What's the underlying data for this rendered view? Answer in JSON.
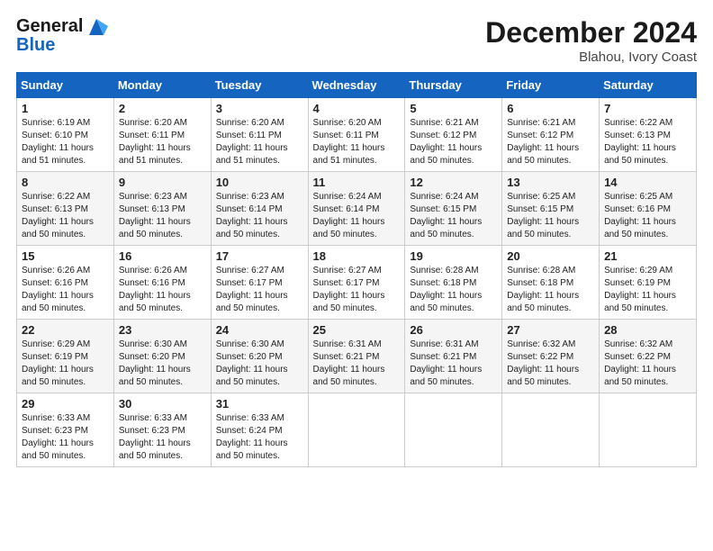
{
  "logo": {
    "line1": "General",
    "line2": "Blue"
  },
  "title": "December 2024",
  "location": "Blahou, Ivory Coast",
  "days_of_week": [
    "Sunday",
    "Monday",
    "Tuesday",
    "Wednesday",
    "Thursday",
    "Friday",
    "Saturday"
  ],
  "weeks": [
    [
      {
        "day": "1",
        "info": "Sunrise: 6:19 AM\nSunset: 6:10 PM\nDaylight: 11 hours\nand 51 minutes."
      },
      {
        "day": "2",
        "info": "Sunrise: 6:20 AM\nSunset: 6:11 PM\nDaylight: 11 hours\nand 51 minutes."
      },
      {
        "day": "3",
        "info": "Sunrise: 6:20 AM\nSunset: 6:11 PM\nDaylight: 11 hours\nand 51 minutes."
      },
      {
        "day": "4",
        "info": "Sunrise: 6:20 AM\nSunset: 6:11 PM\nDaylight: 11 hours\nand 51 minutes."
      },
      {
        "day": "5",
        "info": "Sunrise: 6:21 AM\nSunset: 6:12 PM\nDaylight: 11 hours\nand 50 minutes."
      },
      {
        "day": "6",
        "info": "Sunrise: 6:21 AM\nSunset: 6:12 PM\nDaylight: 11 hours\nand 50 minutes."
      },
      {
        "day": "7",
        "info": "Sunrise: 6:22 AM\nSunset: 6:13 PM\nDaylight: 11 hours\nand 50 minutes."
      }
    ],
    [
      {
        "day": "8",
        "info": "Sunrise: 6:22 AM\nSunset: 6:13 PM\nDaylight: 11 hours\nand 50 minutes."
      },
      {
        "day": "9",
        "info": "Sunrise: 6:23 AM\nSunset: 6:13 PM\nDaylight: 11 hours\nand 50 minutes."
      },
      {
        "day": "10",
        "info": "Sunrise: 6:23 AM\nSunset: 6:14 PM\nDaylight: 11 hours\nand 50 minutes."
      },
      {
        "day": "11",
        "info": "Sunrise: 6:24 AM\nSunset: 6:14 PM\nDaylight: 11 hours\nand 50 minutes."
      },
      {
        "day": "12",
        "info": "Sunrise: 6:24 AM\nSunset: 6:15 PM\nDaylight: 11 hours\nand 50 minutes."
      },
      {
        "day": "13",
        "info": "Sunrise: 6:25 AM\nSunset: 6:15 PM\nDaylight: 11 hours\nand 50 minutes."
      },
      {
        "day": "14",
        "info": "Sunrise: 6:25 AM\nSunset: 6:16 PM\nDaylight: 11 hours\nand 50 minutes."
      }
    ],
    [
      {
        "day": "15",
        "info": "Sunrise: 6:26 AM\nSunset: 6:16 PM\nDaylight: 11 hours\nand 50 minutes."
      },
      {
        "day": "16",
        "info": "Sunrise: 6:26 AM\nSunset: 6:16 PM\nDaylight: 11 hours\nand 50 minutes."
      },
      {
        "day": "17",
        "info": "Sunrise: 6:27 AM\nSunset: 6:17 PM\nDaylight: 11 hours\nand 50 minutes."
      },
      {
        "day": "18",
        "info": "Sunrise: 6:27 AM\nSunset: 6:17 PM\nDaylight: 11 hours\nand 50 minutes."
      },
      {
        "day": "19",
        "info": "Sunrise: 6:28 AM\nSunset: 6:18 PM\nDaylight: 11 hours\nand 50 minutes."
      },
      {
        "day": "20",
        "info": "Sunrise: 6:28 AM\nSunset: 6:18 PM\nDaylight: 11 hours\nand 50 minutes."
      },
      {
        "day": "21",
        "info": "Sunrise: 6:29 AM\nSunset: 6:19 PM\nDaylight: 11 hours\nand 50 minutes."
      }
    ],
    [
      {
        "day": "22",
        "info": "Sunrise: 6:29 AM\nSunset: 6:19 PM\nDaylight: 11 hours\nand 50 minutes."
      },
      {
        "day": "23",
        "info": "Sunrise: 6:30 AM\nSunset: 6:20 PM\nDaylight: 11 hours\nand 50 minutes."
      },
      {
        "day": "24",
        "info": "Sunrise: 6:30 AM\nSunset: 6:20 PM\nDaylight: 11 hours\nand 50 minutes."
      },
      {
        "day": "25",
        "info": "Sunrise: 6:31 AM\nSunset: 6:21 PM\nDaylight: 11 hours\nand 50 minutes."
      },
      {
        "day": "26",
        "info": "Sunrise: 6:31 AM\nSunset: 6:21 PM\nDaylight: 11 hours\nand 50 minutes."
      },
      {
        "day": "27",
        "info": "Sunrise: 6:32 AM\nSunset: 6:22 PM\nDaylight: 11 hours\nand 50 minutes."
      },
      {
        "day": "28",
        "info": "Sunrise: 6:32 AM\nSunset: 6:22 PM\nDaylight: 11 hours\nand 50 minutes."
      }
    ],
    [
      {
        "day": "29",
        "info": "Sunrise: 6:33 AM\nSunset: 6:23 PM\nDaylight: 11 hours\nand 50 minutes."
      },
      {
        "day": "30",
        "info": "Sunrise: 6:33 AM\nSunset: 6:23 PM\nDaylight: 11 hours\nand 50 minutes."
      },
      {
        "day": "31",
        "info": "Sunrise: 6:33 AM\nSunset: 6:24 PM\nDaylight: 11 hours\nand 50 minutes."
      },
      {
        "day": "",
        "info": ""
      },
      {
        "day": "",
        "info": ""
      },
      {
        "day": "",
        "info": ""
      },
      {
        "day": "",
        "info": ""
      }
    ]
  ]
}
